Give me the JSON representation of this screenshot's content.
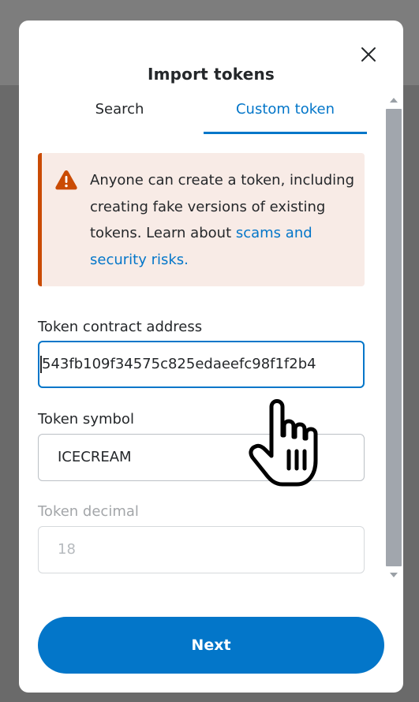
{
  "modal": {
    "title": "Import tokens",
    "close_icon": "close-icon"
  },
  "tabs": [
    {
      "label": "Search",
      "active": false
    },
    {
      "label": "Custom token",
      "active": true
    }
  ],
  "warning": {
    "icon": "warning-triangle-icon",
    "text": "Anyone can create a token, including creating fake versions of existing tokens. Learn about ",
    "link_text": "scams and security risks."
  },
  "fields": {
    "contract_address": {
      "label": "Token contract address",
      "value": "543fb109f34575c825edaeefc98f1f2b4"
    },
    "symbol": {
      "label": "Token symbol",
      "value": "ICECREAM"
    },
    "decimal": {
      "label": "Token decimal",
      "placeholder": "18"
    }
  },
  "next_button": {
    "label": "Next"
  },
  "cursor_icon": "hand-pointer-icon",
  "colors": {
    "accent": "#0376c9",
    "warning": "#ca4b04",
    "warning_bg": "#f8ebe6",
    "text": "#24272a"
  }
}
